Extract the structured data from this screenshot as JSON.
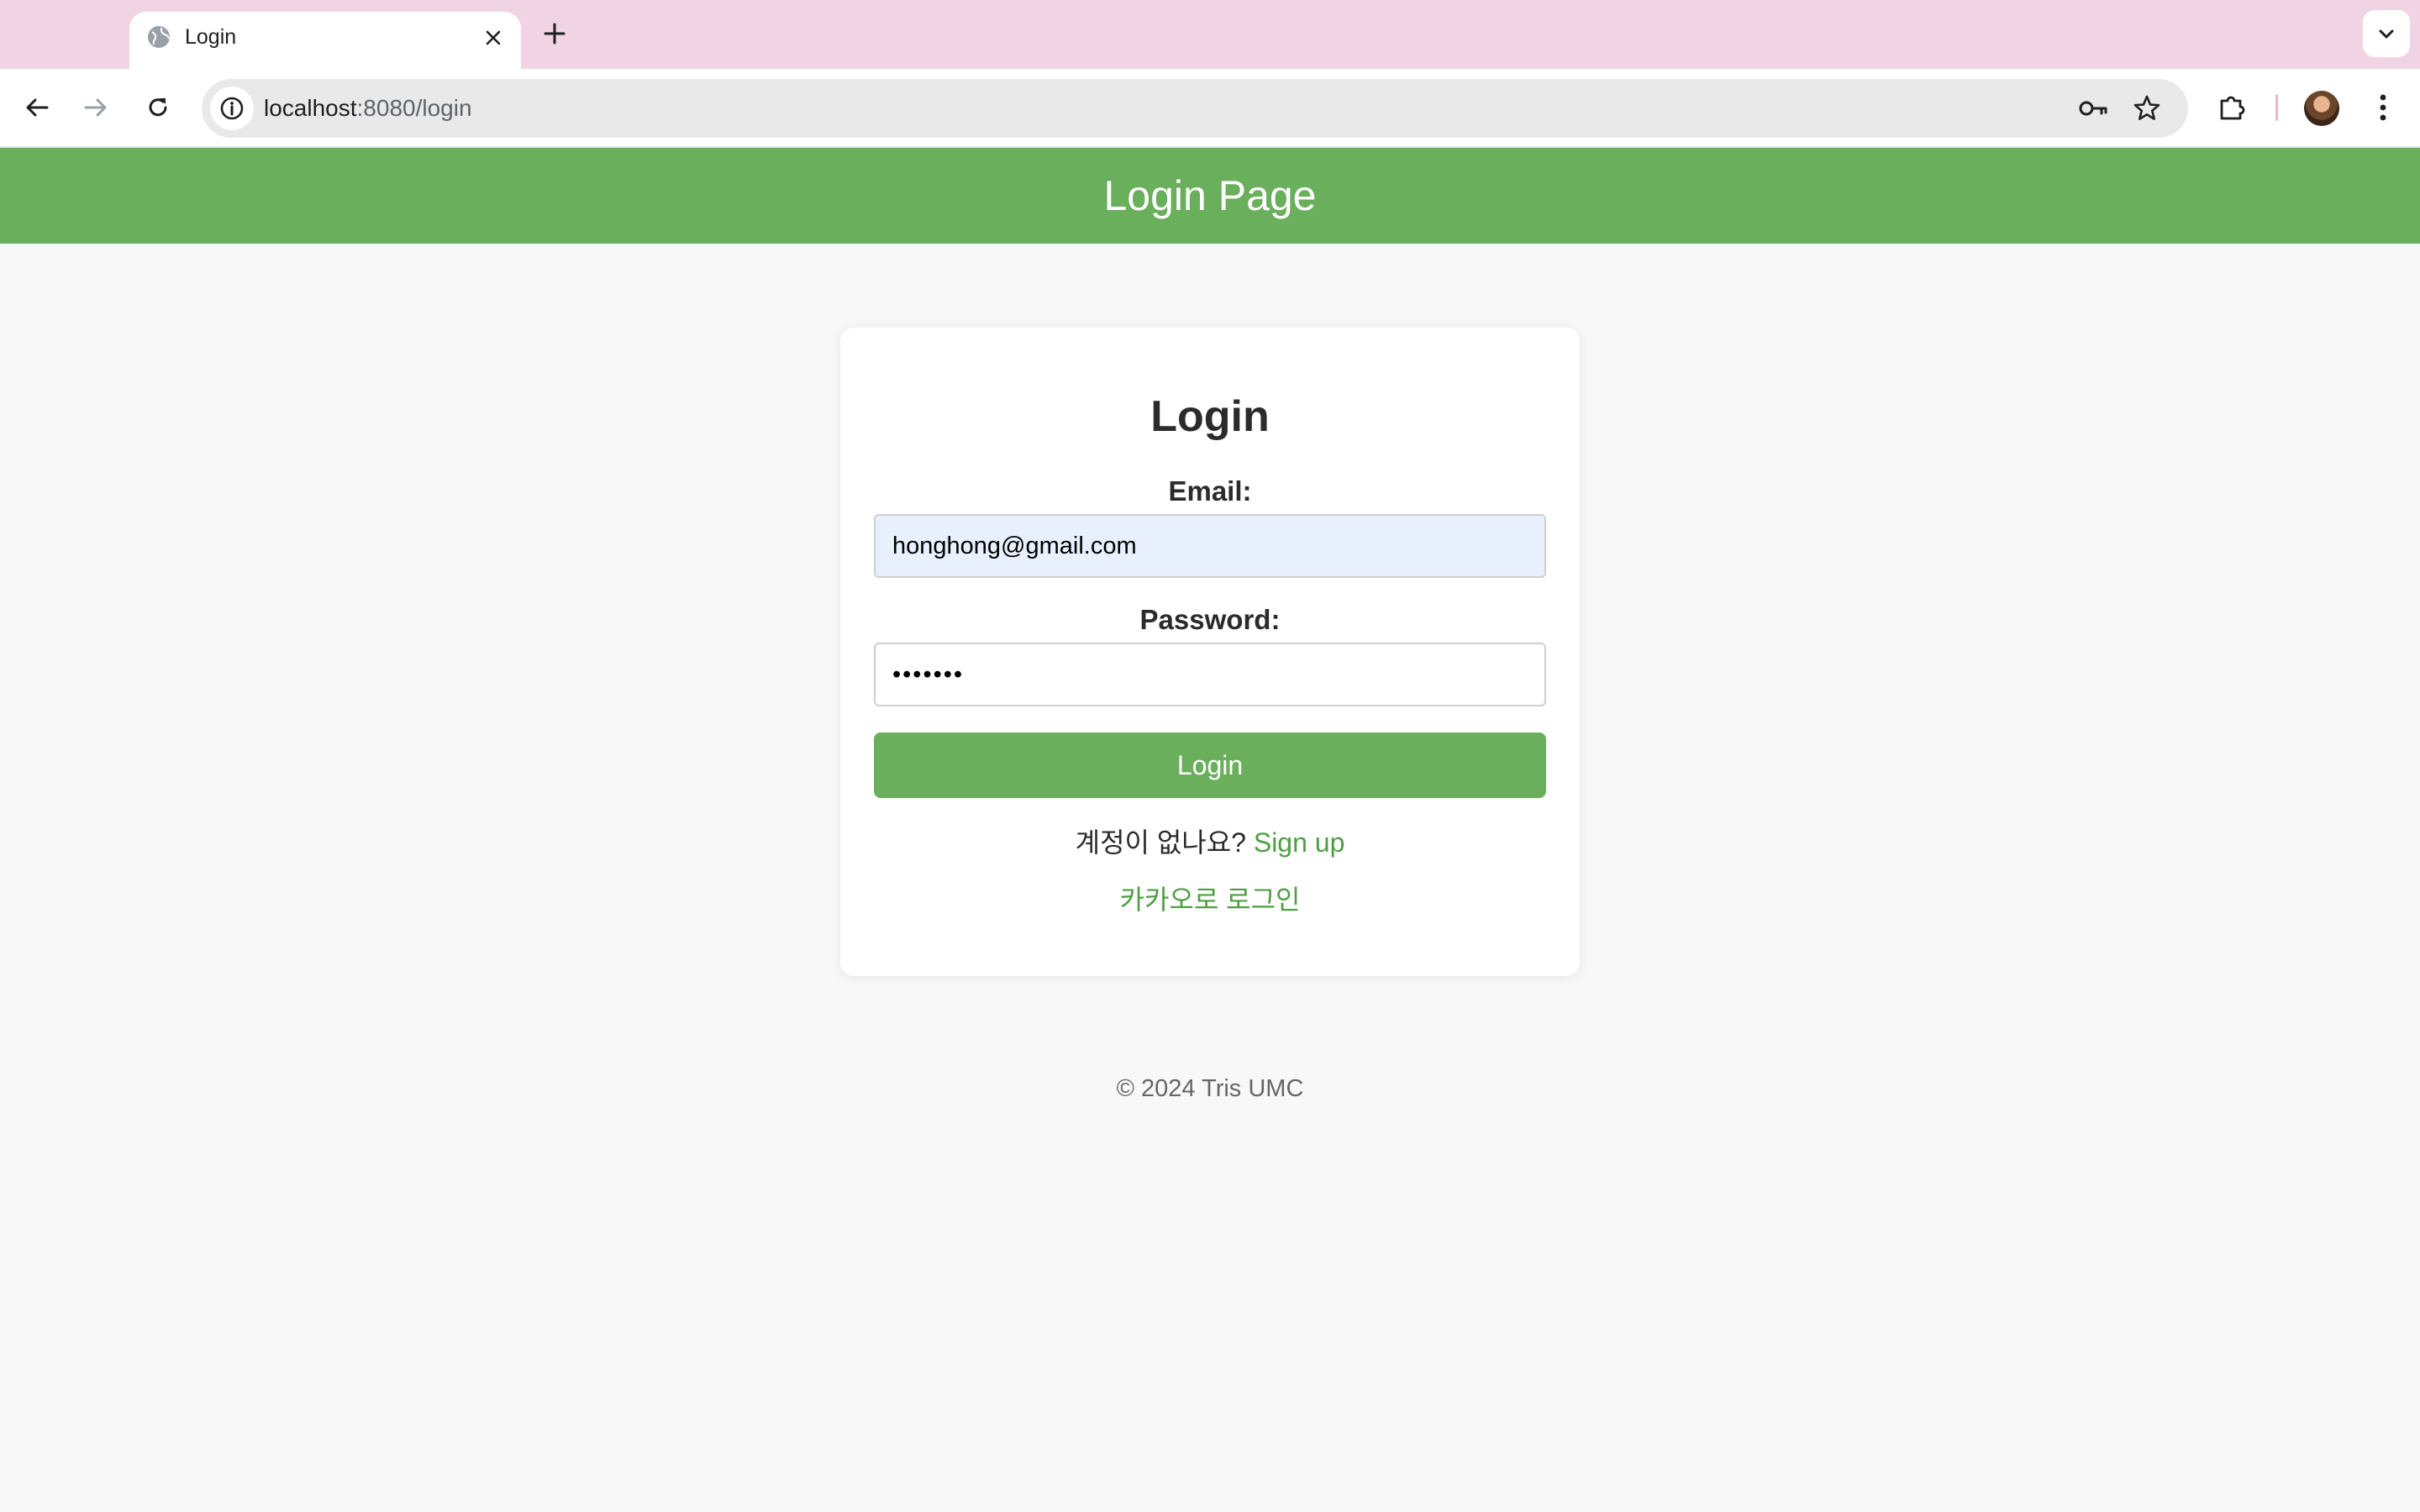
{
  "browser": {
    "tab": {
      "title": "Login",
      "favicon": "globe-icon",
      "close_icon": "close-icon"
    },
    "new_tab_icon": "plus-icon",
    "tab_list_icon": "chevron-down-icon",
    "toolbar": {
      "back_icon": "back-arrow-icon",
      "forward_icon": "forward-arrow-icon",
      "reload_icon": "reload-icon",
      "site_info_icon": "info-icon",
      "url_host": "localhost",
      "url_rest": ":8080/login",
      "password_key_icon": "key-icon",
      "bookmark_icon": "star-icon",
      "extensions_icon": "puzzle-icon",
      "menu_icon": "kebab-menu-icon"
    }
  },
  "page": {
    "header_title": "Login Page",
    "card": {
      "title": "Login",
      "email_label": "Email:",
      "email_value": "honghong@gmail.com",
      "password_label": "Password:",
      "password_value": "•••••••",
      "login_button": "Login",
      "signup_prompt": "계정이 없나요?",
      "signup_link": "Sign up",
      "kakao_link": "카카오로 로그인"
    },
    "footer": "© 2024 Tris UMC"
  },
  "colors": {
    "brand_green": "#6aaf5c",
    "link_green": "#4f9e44",
    "tabstrip_pink": "#f1d4e3",
    "autofill_blue": "#e8f0fe"
  }
}
